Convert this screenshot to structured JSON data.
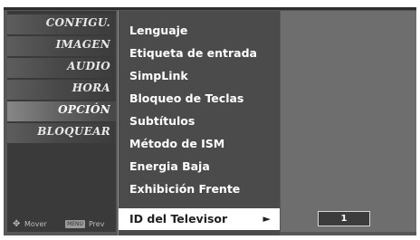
{
  "categories": [
    {
      "label": "CONFIGU.",
      "icon": "gear-icon"
    },
    {
      "label": "IMAGEN",
      "icon": "picture-icon"
    },
    {
      "label": "AUDIO",
      "icon": "speaker-icon"
    },
    {
      "label": "HORA",
      "icon": "clock-icon"
    },
    {
      "label": "OPCIÓN",
      "icon": "option-icon"
    },
    {
      "label": "BLOQUEAR",
      "icon": "lock-icon"
    }
  ],
  "active_category": "OPCIÓN",
  "hint": {
    "move_label": "Mover",
    "menu_key": "MENU",
    "prev_label": "Prev"
  },
  "submenu": {
    "items": [
      {
        "label": "Lenguaje"
      },
      {
        "label": "Etiqueta de entrada"
      },
      {
        "label": "SimpLink"
      },
      {
        "label": "Bloqueo de Teclas"
      },
      {
        "label": "Subtítulos"
      },
      {
        "label": "Método de ISM"
      },
      {
        "label": "Energia Baja"
      },
      {
        "label": "Exhibición Frente"
      },
      {
        "label": "ID del Televisor",
        "selected": true
      }
    ]
  },
  "value": {
    "current": "1"
  },
  "colors": {
    "highlight": "#ffffff",
    "menu_bg": "#4b4b4b",
    "panel_bg": "#6e6e6e"
  }
}
